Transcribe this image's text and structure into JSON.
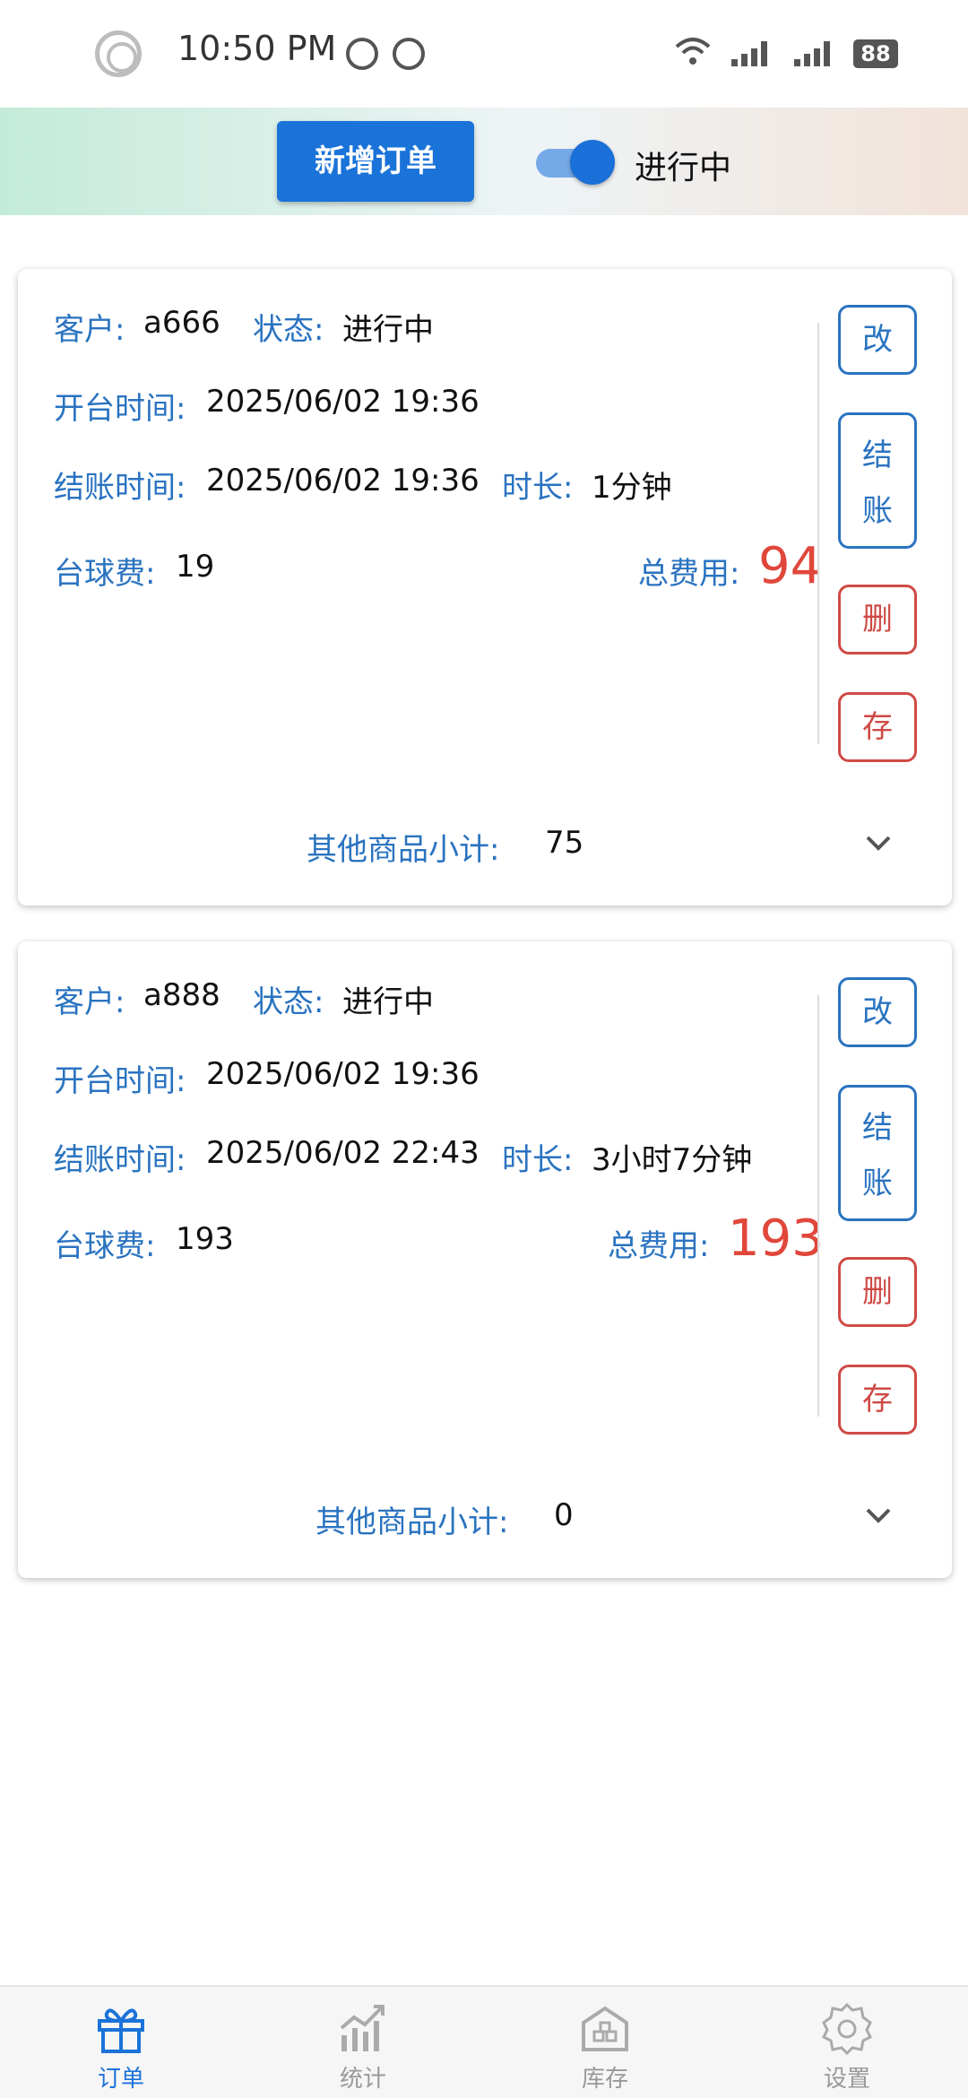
{
  "status_bar": {
    "time": "10:50 PM",
    "battery": "88"
  },
  "toolbar": {
    "add_order_label": "新增订单",
    "toggle_label": "进行中",
    "toggle_on": true
  },
  "labels": {
    "customer": "客户:",
    "status": "状态:",
    "open_time": "开台时间:",
    "checkout_time": "结账时间:",
    "duration": "时长:",
    "table_fee": "台球费:",
    "total": "总费用:",
    "other_subtotal": "其他商品小计:"
  },
  "actions": {
    "edit": "改",
    "checkout_1": "结",
    "checkout_2": "账",
    "delete": "删",
    "save": "存"
  },
  "orders": [
    {
      "customer": "a666",
      "status": "进行中",
      "open_time": "2025/06/02 19:36",
      "checkout_time": "2025/06/02 19:36",
      "duration": "1分钟",
      "table_fee": "19",
      "total": "94",
      "other_subtotal": "75"
    },
    {
      "customer": "a888",
      "status": "进行中",
      "open_time": "2025/06/02 19:36",
      "checkout_time": "2025/06/02 22:43",
      "duration": "3小时7分钟",
      "table_fee": "193",
      "total": "193",
      "other_subtotal": "0"
    }
  ],
  "bottom_nav": [
    {
      "label": "订单",
      "icon": "gift-icon",
      "active": true
    },
    {
      "label": "统计",
      "icon": "chart-icon",
      "active": false
    },
    {
      "label": "库存",
      "icon": "warehouse-icon",
      "active": false
    },
    {
      "label": "设置",
      "icon": "gear-icon",
      "active": false
    }
  ],
  "colors": {
    "primary": "#1a73d9",
    "label_blue": "#2a73c0",
    "danger": "#cf4a45",
    "total_red": "#e0473a"
  }
}
